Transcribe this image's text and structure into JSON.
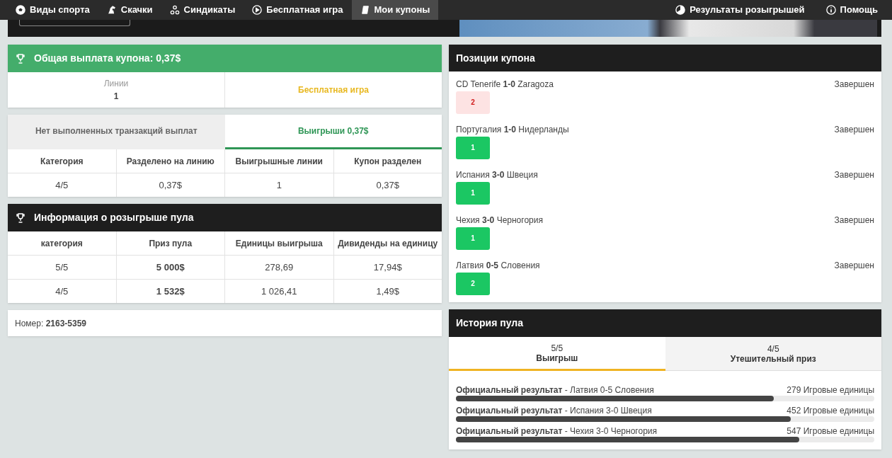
{
  "nav": {
    "items": [
      {
        "label": "Виды спорта",
        "selected": false
      },
      {
        "label": "Скачки",
        "selected": false
      },
      {
        "label": "Синдикаты",
        "selected": false
      },
      {
        "label": "Бесплатная игра",
        "selected": false
      },
      {
        "label": "Мои купоны",
        "selected": true
      }
    ],
    "right": [
      {
        "label": "Результаты розыгрышей"
      },
      {
        "label": "Помощь"
      }
    ]
  },
  "payout": {
    "title": "Общая выплата купона: 0,37$",
    "lines_label": "Линии",
    "lines_value": "1",
    "game_type": "Бесплатная игра"
  },
  "winnings": {
    "tabs": [
      {
        "label": "Нет выполненных транзакций выплат",
        "selected": false
      },
      {
        "label": "Выигрыши 0,37$",
        "selected": true
      }
    ],
    "columns": [
      "Категория",
      "Разделено на линию",
      "Выигрышные линии",
      "Купон разделен"
    ],
    "rows": [
      [
        "4/5",
        "0,37$",
        "1",
        "0,37$"
      ]
    ]
  },
  "pool_info": {
    "title": "Информация о розыгрыше пула",
    "columns": [
      "категория",
      "Приз пула",
      "Единицы выигрыша",
      "Дивиденды на единицу"
    ],
    "rows": [
      [
        "5/5",
        "5 000$",
        "278,69",
        "17,94$"
      ],
      [
        "4/5",
        "1 532$",
        "1 026,41",
        "1,49$"
      ]
    ]
  },
  "ticket": {
    "label": "Номер:",
    "number": "2163-5359"
  },
  "positions": {
    "title": "Позиции купона",
    "items": [
      {
        "match": "CD Tenerife **1-0** Zaragoza",
        "status": "Завершен",
        "pick": "2",
        "kind": "lost"
      },
      {
        "match": "Португалия **1-0** Нидерланды",
        "status": "Завершен",
        "pick": "1",
        "kind": "won"
      },
      {
        "match": "Испания **3-0** Швеция",
        "status": "Завершен",
        "pick": "1",
        "kind": "won"
      },
      {
        "match": "Чехия **3-0** Черногория",
        "status": "Завершен",
        "pick": "1",
        "kind": "won"
      },
      {
        "match": "Латвия **0-5** Словения",
        "status": "Завершен",
        "pick": "2",
        "kind": "won"
      }
    ]
  },
  "history": {
    "title": "История пула",
    "tabs": [
      {
        "top": "5/5",
        "label": "Выигрыш",
        "selected": true
      },
      {
        "top": "4/5",
        "label": "Утешительный приз",
        "selected": false
      }
    ],
    "results": [
      {
        "text": "**Официальный результат** - Латвия 0-5 Словения",
        "units": "279 Игровые единицы",
        "level": 0.76
      },
      {
        "text": "**Официальный результат** - Испания 3-0 Швеция",
        "units": "452 Игровые единицы",
        "level": 0.8
      },
      {
        "text": "**Официальный результат** - Чехия 3-0 Черногория",
        "units": "547 Игровые единицы",
        "level": 0.82
      }
    ]
  }
}
